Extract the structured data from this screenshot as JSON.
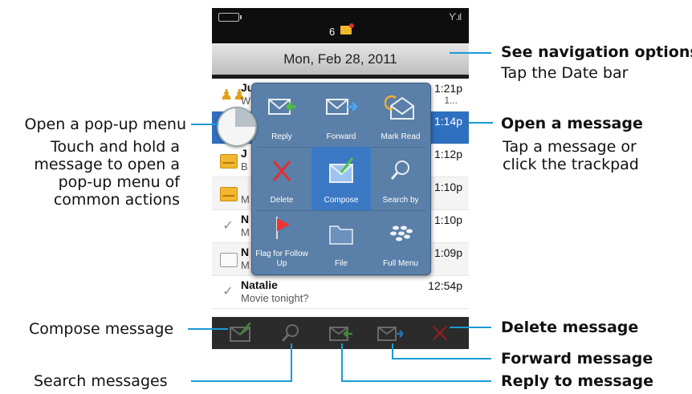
{
  "status_bar": {
    "unread_count": "6"
  },
  "date_bar": {
    "label": "Mon, Feb 28, 2011"
  },
  "messages": [
    {
      "name": "Juan",
      "preview": "W",
      "time": "1:21p",
      "extra": "1..."
    },
    {
      "name": "",
      "preview": "",
      "time": "1:14p"
    },
    {
      "name": "J",
      "preview": "B",
      "time": "1:12p"
    },
    {
      "name": "",
      "preview": "M",
      "time": "1:10p"
    },
    {
      "name": "N",
      "preview": "M",
      "time": "1:10p"
    },
    {
      "name": "N",
      "preview": "M",
      "time": "1:09p"
    },
    {
      "name": "Natalie",
      "preview": "Movie tonight?",
      "time": "12:54p"
    }
  ],
  "popup_menu": {
    "items": [
      {
        "label": "Reply",
        "icon": "reply-icon"
      },
      {
        "label": "Forward",
        "icon": "forward-icon"
      },
      {
        "label": "Mark Read",
        "icon": "mark-read-icon"
      },
      {
        "label": "Delete",
        "icon": "delete-icon"
      },
      {
        "label": "Compose",
        "icon": "compose-icon"
      },
      {
        "label": "Search by",
        "icon": "search-icon"
      },
      {
        "label": "Flag for Follow Up",
        "icon": "flag-icon"
      },
      {
        "label": "File",
        "icon": "folder-icon"
      },
      {
        "label": "Full Menu",
        "icon": "blackberry-icon"
      }
    ]
  },
  "toolbar": [
    "compose-icon",
    "search-icon",
    "reply-icon",
    "forward-icon",
    "delete-icon"
  ],
  "annotations": {
    "nav_title": "See navigation options",
    "nav_sub": "Tap the Date bar",
    "open_title": "Open a message",
    "open_sub1": "Tap a message or",
    "open_sub2": "click the trackpad",
    "popup_title": "Open a pop-up menu",
    "popup_sub1": "Touch and hold a",
    "popup_sub2": "message to open a",
    "popup_sub3": "pop-up menu of",
    "popup_sub4": "common actions",
    "compose": "Compose message",
    "search": "Search messages",
    "delete": "Delete message",
    "forward": "Forward message",
    "reply": "Reply to message"
  },
  "colors": {
    "callout_line": "#1a9ad6",
    "selection": "#2f6fbf",
    "popup": "#5a7fa8"
  }
}
